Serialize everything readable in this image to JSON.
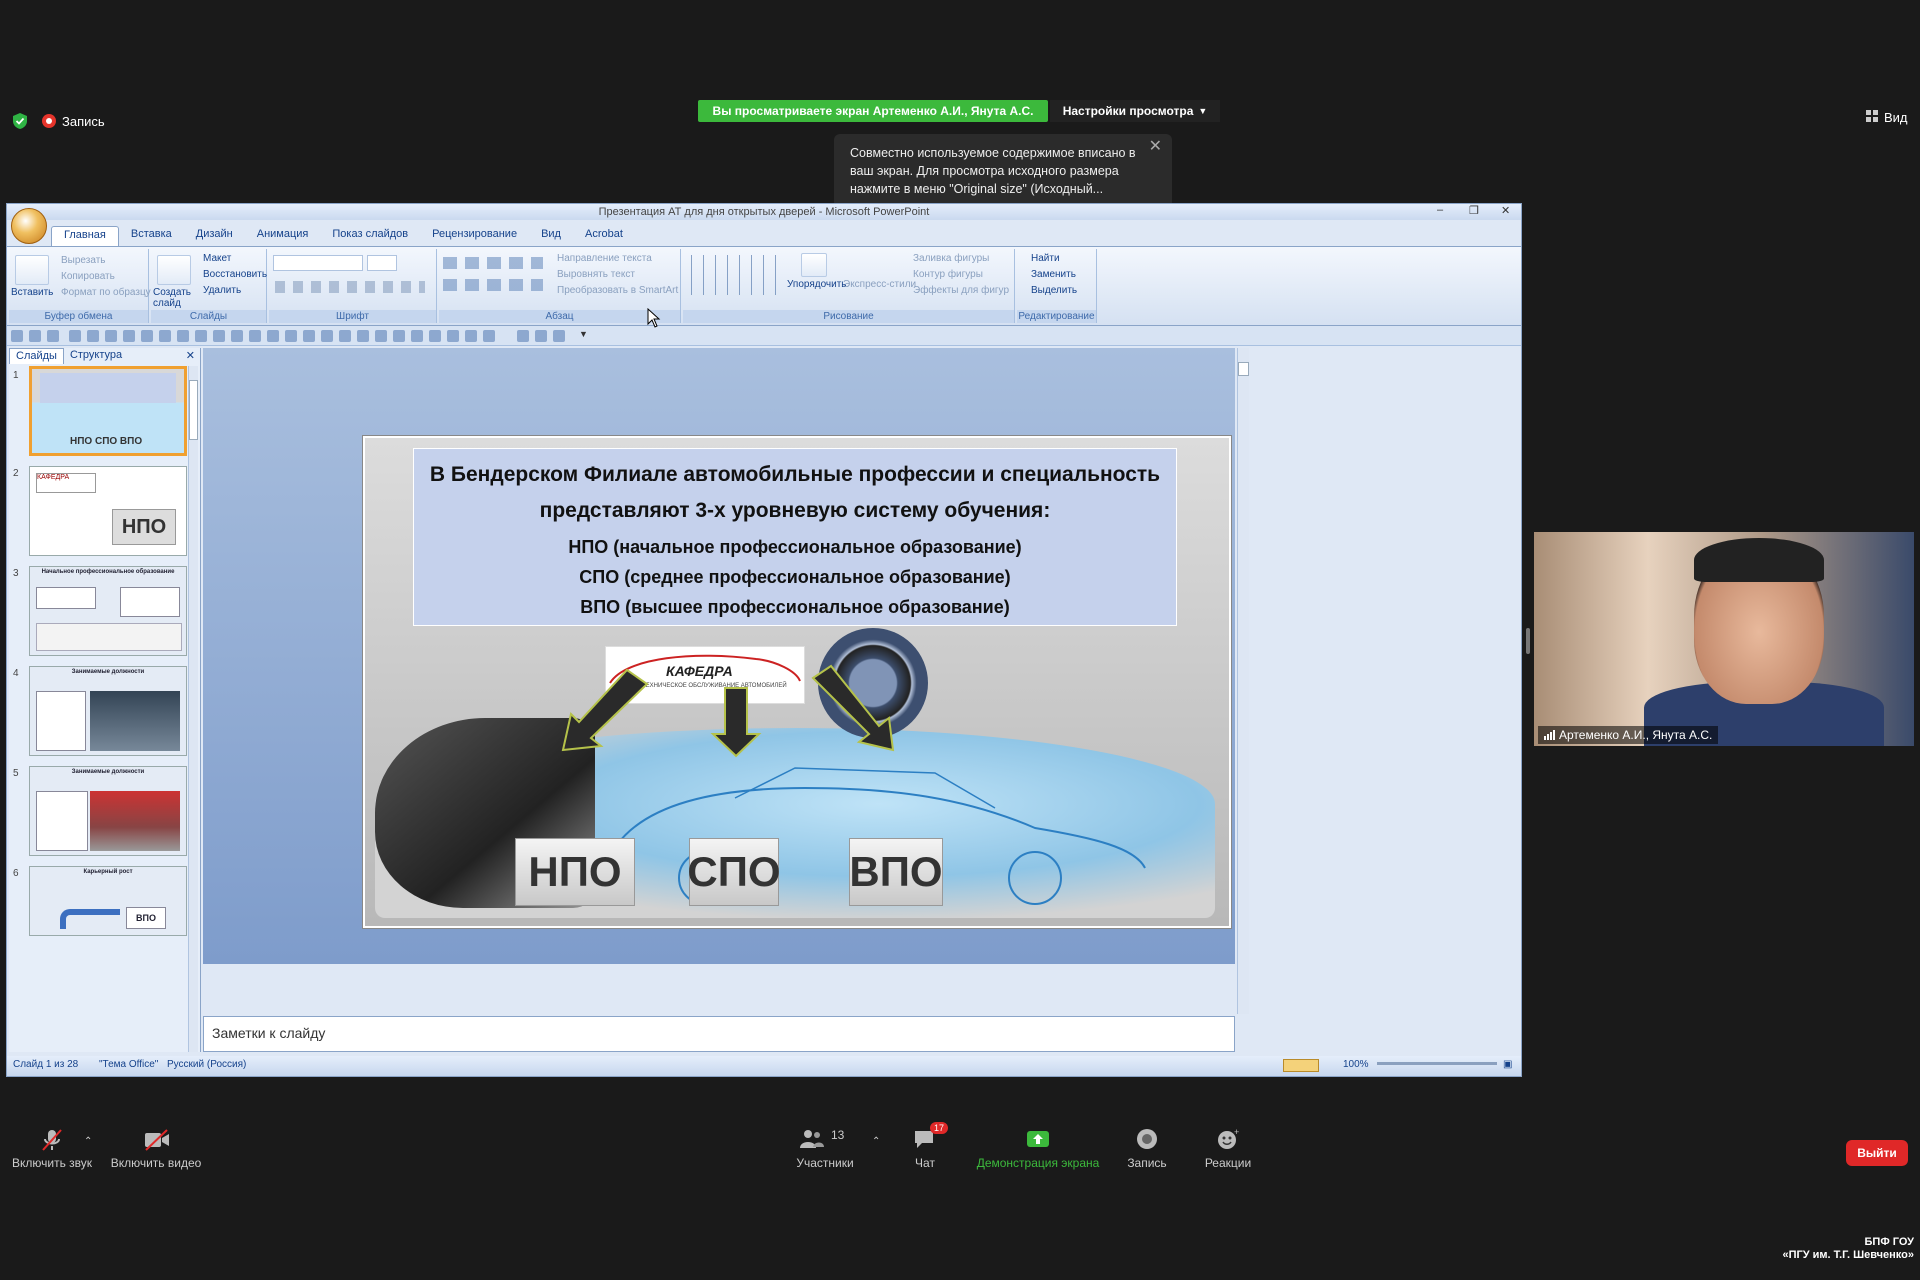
{
  "zoom_top": {
    "record_label": "Запись",
    "sharing_banner": "Вы просматриваете экран Артеменко А.И., Янута А.С.",
    "view_options": "Настройки просмотра",
    "view_label": "Вид",
    "tooltip": "Совместно используемое содержимое вписано в ваш экран. Для просмотра исходного размера нажмите в меню \"Original size\" (Исходный..."
  },
  "ppt": {
    "window_title": "Презентация АТ для дня открытых дверей - Microsoft PowerPoint",
    "tabs": [
      "Главная",
      "Вставка",
      "Дизайн",
      "Анимация",
      "Показ слайдов",
      "Рецензирование",
      "Вид",
      "Acrobat"
    ],
    "ribbon": {
      "paste": "Вставить",
      "cut": "Вырезать",
      "copy": "Копировать",
      "format_painter": "Формат по образцу",
      "clipboard_group": "Буфер обмена",
      "new_slide": "Создать слайд",
      "layout": "Макет",
      "reset": "Восстановить",
      "delete": "Удалить",
      "slides_group": "Слайды",
      "font_group": "Шрифт",
      "text_direction": "Направление текста",
      "align_text": "Выровнять текст",
      "smartart": "Преобразовать в SmartArt",
      "paragraph_group": "Абзац",
      "arrange": "Упорядочить",
      "quick_styles": "Экспресс-стили",
      "shape_fill": "Заливка фигуры",
      "shape_outline": "Контур фигуры",
      "shape_effects": "Эффекты для фигур",
      "drawing_group": "Рисование",
      "find": "Найти",
      "replace": "Заменить",
      "select": "Выделить",
      "editing_group": "Редактирование"
    },
    "pane_tabs": [
      "Слайды",
      "Структура"
    ],
    "thumbs": [
      {
        "num": "1",
        "text": "НПО СПО ВПО"
      },
      {
        "num": "2",
        "text": "НПО"
      },
      {
        "num": "3",
        "text": "Начальное профессиональное образование"
      },
      {
        "num": "4",
        "text": "Занимаемые должности"
      },
      {
        "num": "5",
        "text": "Занимаемые должности"
      },
      {
        "num": "6",
        "text": "Карьерный рост"
      }
    ],
    "slide": {
      "line1": "В Бендерском Филиале автомобильные профессии и специальность",
      "line2": "представляют 3-х уровневую систему обучения:",
      "line3": "НПО (начальное профессиональное образование)",
      "line4": "СПО (среднее профессиональное образование)",
      "line5": "ВПО (высшее профессиональное образование)",
      "kafedra": "КАФЕДРА",
      "kafedra_sub": "ТЕХНИЧЕСКОЕ ОБСЛУЖИВАНИЕ АВТОМОБИЛЕЙ",
      "level1": "НПО",
      "level2": "СПО",
      "level3": "ВПО"
    },
    "notes": "Заметки к слайду",
    "status": {
      "slide_of": "Слайд 1 из 28",
      "theme": "\"Тема Office\"",
      "language": "Русский (Россия)",
      "zoom": "100%"
    }
  },
  "webcam": {
    "name": "Артеменко А.И., Янута А.С."
  },
  "toolbar": {
    "unmute": "Включить звук",
    "start_video": "Включить видео",
    "participants": "Участники",
    "participants_count": "13",
    "chat": "Чат",
    "chat_badge": "17",
    "share": "Демонстрация экрана",
    "record": "Запись",
    "reactions": "Реакции",
    "leave": "Выйти"
  },
  "watermark": {
    "line1": "БПФ ГОУ",
    "line2": "«ПГУ им. Т.Г. Шевченко»"
  },
  "colors": {
    "zoom_green": "#3cb93c",
    "leave_red": "#e02828",
    "ppt_blue": "#15428b"
  }
}
